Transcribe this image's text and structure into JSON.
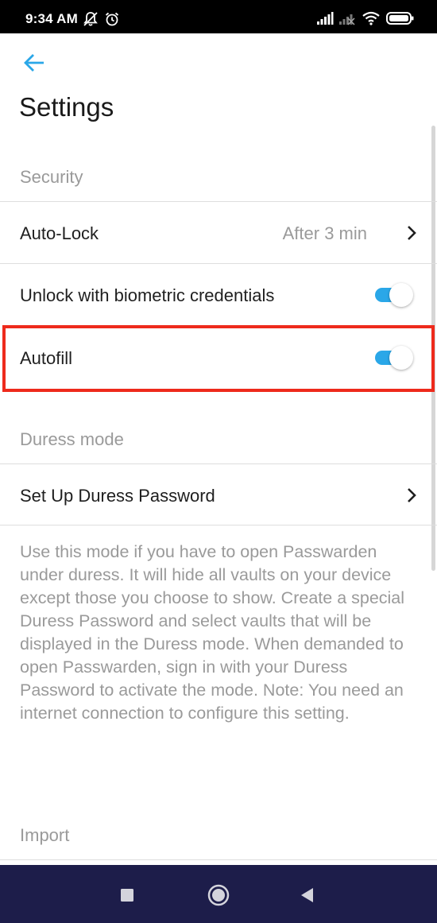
{
  "status_bar": {
    "time": "9:34 AM",
    "icons": [
      "muted-bell-icon",
      "alarm-icon",
      "signal-icon",
      "signal-off-icon",
      "wifi-icon",
      "battery-icon"
    ]
  },
  "header": {
    "back_icon": "arrow-left-icon",
    "title": "Settings"
  },
  "sections": {
    "security": {
      "header": "Security",
      "auto_lock": {
        "label": "Auto-Lock",
        "value": "After 3 min"
      },
      "biometric": {
        "label": "Unlock with biometric credentials",
        "enabled": true
      },
      "autofill": {
        "label": "Autofill",
        "enabled": true
      }
    },
    "duress": {
      "header": "Duress mode",
      "setup": {
        "label": "Set Up Duress Password"
      },
      "description": "Use this mode if you have to open Passwarden under duress. It will hide all vaults on your device except those you choose to show. Create a special Duress Password and select vaults that will be displayed in the Duress mode. When demanded to open Passwarden, sign in with your Duress Password to activate the mode. Note: You need an internet connection to configure this setting."
    },
    "import": {
      "header": "Import"
    }
  },
  "nav_bar": {
    "icons": [
      "recents-square-icon",
      "home-circle-icon",
      "back-triangle-icon"
    ]
  },
  "colors": {
    "accent": "#2aa7e8",
    "highlight": "#ee2a1c",
    "nav_background": "#1d1d4a",
    "secondary_text": "#9a9a9a"
  }
}
